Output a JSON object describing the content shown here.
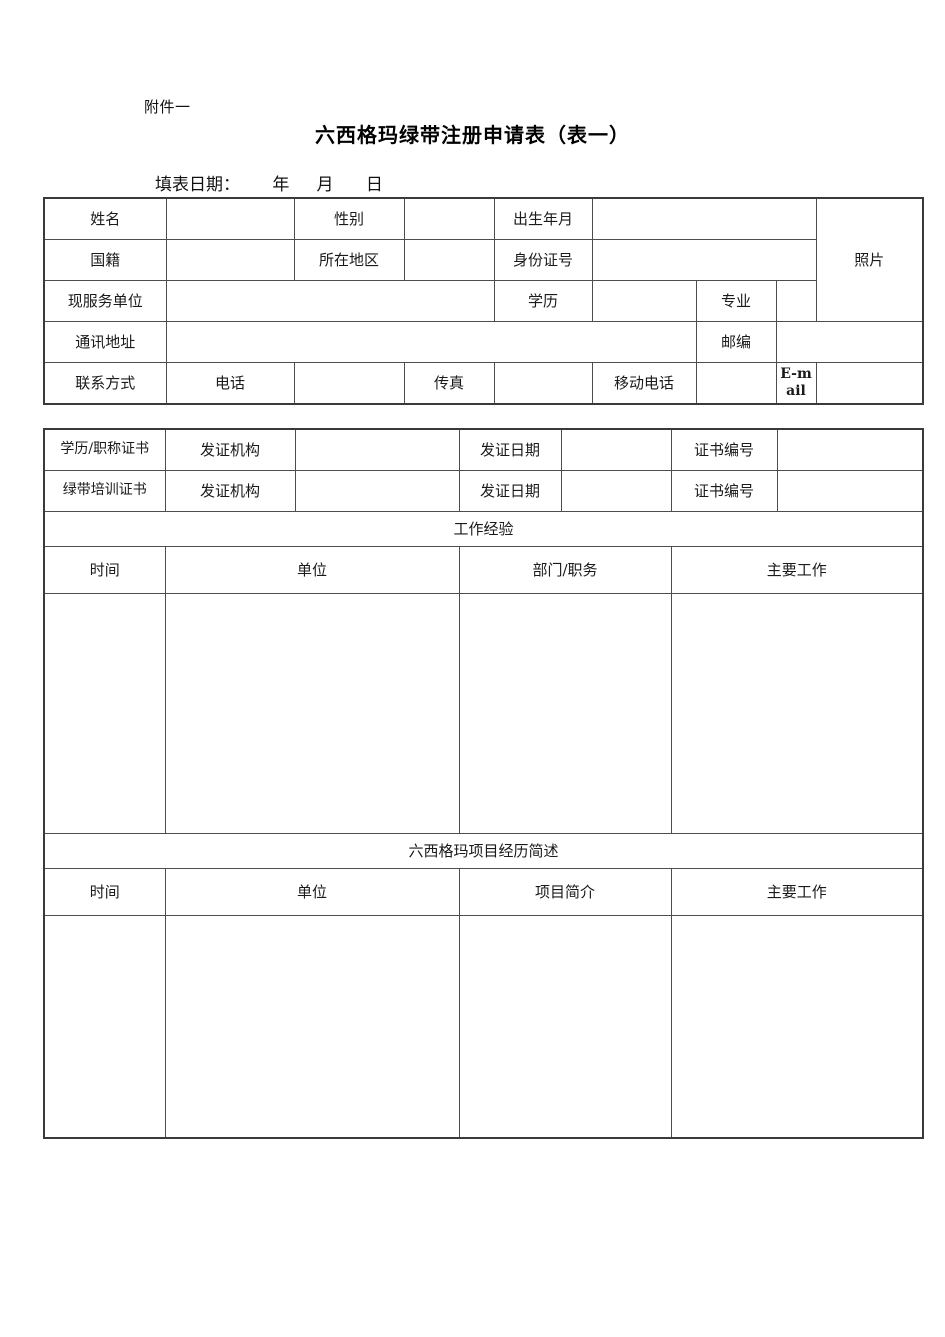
{
  "header": {
    "attachment_label": "附件一",
    "title": "六西格玛绿带注册申请表（表一）",
    "fill_date_label": "填表日期：",
    "year_unit": "年",
    "month_unit": "月",
    "day_unit": "日",
    "fill_date_line": "填表日期：      年     月      日"
  },
  "personal_table": {
    "name_label": "姓名",
    "gender_label": "性别",
    "birth_label": "出生年月",
    "photo_label": "照片",
    "nationality_label": "国籍",
    "region_label": "所在地区",
    "id_number_label": "身份证号",
    "current_employer_label": "现服务单位",
    "education_label": "学历",
    "major_label": "专业",
    "address_label": "通讯地址",
    "postcode_label": "邮编",
    "contact_label": "联系方式",
    "phone_label": "电话",
    "fax_label": "传真",
    "mobile_label": "移动电话",
    "email_label": "E-mail",
    "values": {
      "name": "",
      "gender": "",
      "birth": "",
      "nationality": "",
      "region": "",
      "id_number": "",
      "current_employer": "",
      "education": "",
      "major": "",
      "address": "",
      "postcode": "",
      "phone": "",
      "fax": "",
      "mobile": "",
      "email": ""
    }
  },
  "certificates": {
    "degree_cert_label": "学历/职称证书",
    "greenbelt_cert_label": "绿带培训证书",
    "issuer_label": "发证机构",
    "issue_date_label": "发证日期",
    "cert_number_label": "证书编号",
    "values": {
      "degree_issuer": "",
      "degree_issue_date": "",
      "degree_cert_number": "",
      "greenbelt_issuer": "",
      "greenbelt_issue_date": "",
      "greenbelt_cert_number": ""
    }
  },
  "work_experience": {
    "section_title": "工作经验",
    "columns": [
      "时间",
      "单位",
      "部门/职务",
      "主要工作"
    ],
    "rows": []
  },
  "project_experience": {
    "section_title": "六西格玛项目经历简述",
    "columns": [
      "时间",
      "单位",
      "项目简介",
      "主要工作"
    ],
    "rows": []
  }
}
